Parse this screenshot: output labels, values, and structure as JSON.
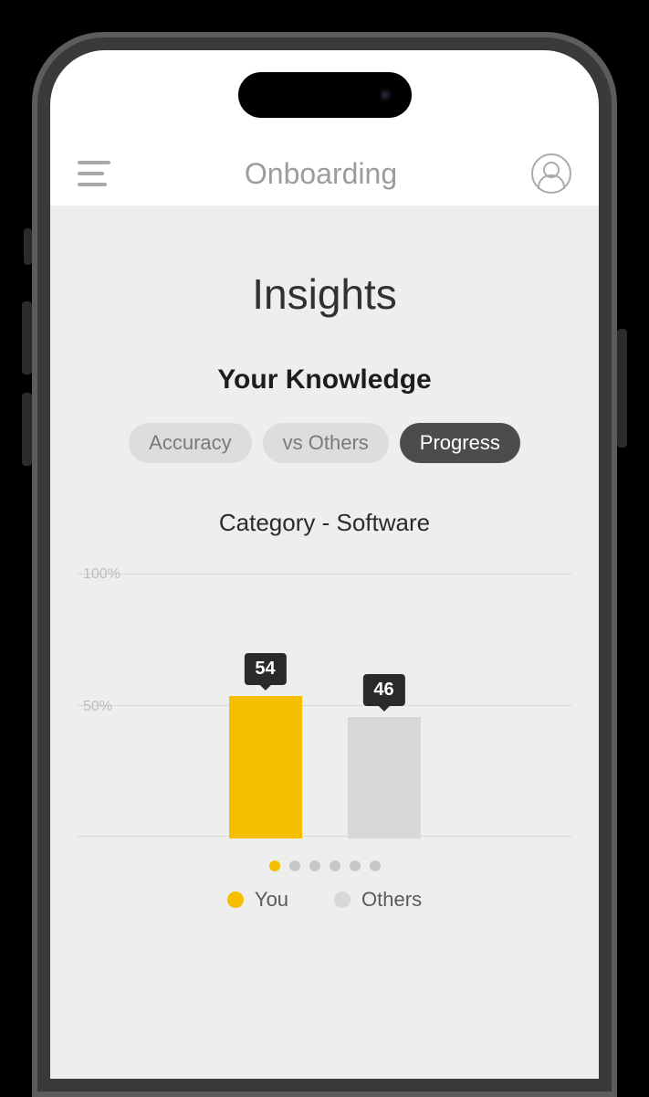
{
  "header": {
    "title": "Onboarding"
  },
  "page": {
    "title": "Insights",
    "subtitle": "Your Knowledge",
    "segments": {
      "accuracy": "Accuracy",
      "vs_others": "vs Others",
      "progress": "Progress"
    },
    "active_segment": "progress",
    "category_label": "Category - Software"
  },
  "chart_data": {
    "type": "bar",
    "title": "Category - Software",
    "xlabel": "",
    "ylabel": "",
    "ylim": [
      0,
      100
    ],
    "y_ticks": [
      "100%",
      "50%"
    ],
    "categories": [
      "You",
      "Others"
    ],
    "values": [
      54,
      46
    ],
    "series": [
      {
        "name": "You",
        "values": [
          54
        ],
        "color": "#f5bf00"
      },
      {
        "name": "Others",
        "values": [
          46
        ],
        "color": "#d8d8d8"
      }
    ]
  },
  "pagination": {
    "count": 6,
    "active": 0
  },
  "legend": {
    "you": "You",
    "others": "Others"
  }
}
